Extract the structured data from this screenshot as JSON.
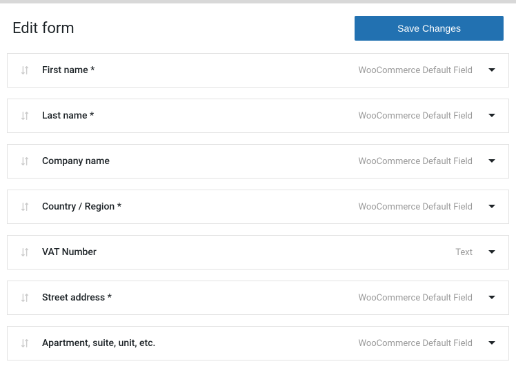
{
  "header": {
    "title": "Edit form",
    "save_label": "Save Changes"
  },
  "fields": [
    {
      "label": "First name *",
      "type": "WooCommerce Default Field"
    },
    {
      "label": "Last name *",
      "type": "WooCommerce Default Field"
    },
    {
      "label": "Company name",
      "type": "WooCommerce Default Field"
    },
    {
      "label": "Country / Region *",
      "type": "WooCommerce Default Field"
    },
    {
      "label": "VAT Number",
      "type": "Text"
    },
    {
      "label": "Street address *",
      "type": "WooCommerce Default Field"
    },
    {
      "label": "Apartment, suite, unit, etc.",
      "type": "WooCommerce Default Field"
    }
  ]
}
